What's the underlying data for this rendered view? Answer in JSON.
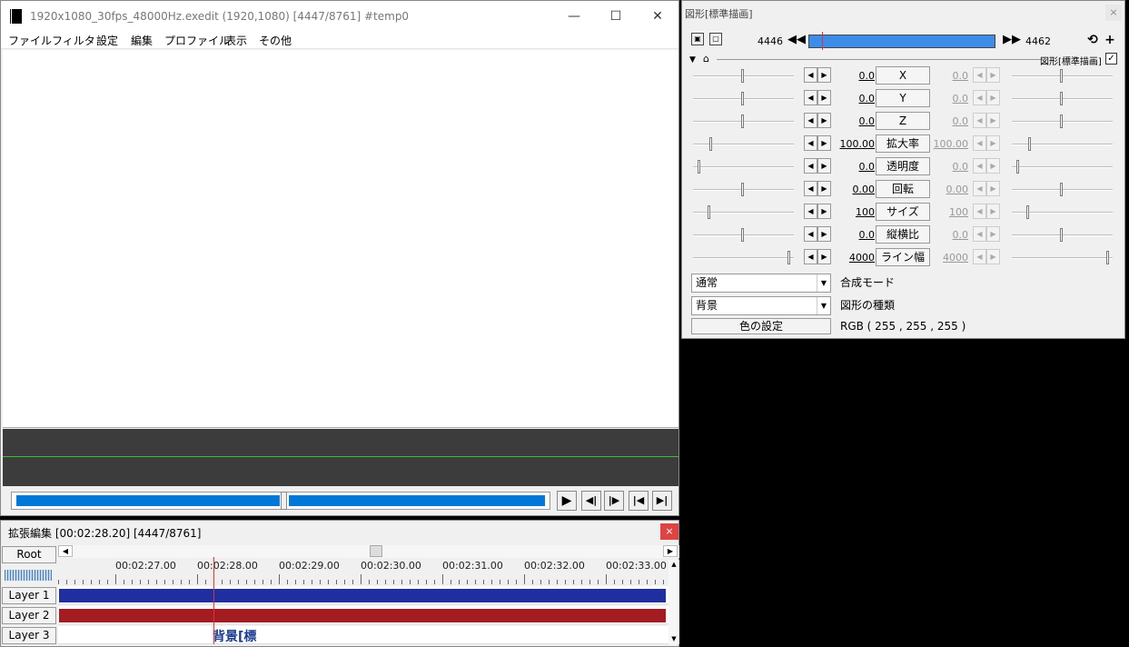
{
  "main_window": {
    "title": "1920x1080_30fps_48000Hz.exedit (1920,1080)  [4447/8761]  #temp0",
    "menu": [
      "ファイル",
      "フィルタ",
      "設定",
      "編集",
      "プロファイル",
      "表示",
      "その他"
    ],
    "window_buttons": {
      "minimize": "—",
      "maximize": "☐",
      "close": "✕"
    },
    "seek_progress": 0.507,
    "playback": {
      "play": "▶",
      "prev": "◀|",
      "next": "|▶",
      "first": "|◀",
      "last": "▶|"
    }
  },
  "timeline": {
    "title": "拡張編集 [00:02:28.20] [4447/8761]",
    "close": "×",
    "root_label": "Root",
    "time_labels": [
      "00:02:27.00",
      "00:02:28.00",
      "00:02:29.00",
      "00:02:30.00",
      "00:02:31.00",
      "00:02:32.00",
      "00:02:33.00"
    ],
    "layers": [
      {
        "label": "Layer 1",
        "clip_color": "#1f2fa0"
      },
      {
        "label": "Layer 2",
        "clip_color": "#a31c22"
      },
      {
        "label": "Layer 3",
        "clip_color": ""
      }
    ],
    "layer3_text": "背景[標",
    "scroll_left": "◀",
    "scroll_right": "▶",
    "scroll_up": "▲",
    "scroll_down": "▼"
  },
  "properties": {
    "title": "図形[標準描画]",
    "close": "×",
    "start_frame": "4446",
    "end_frame": "4462",
    "section_label": "図形[標準描画]",
    "checkmark": "✓",
    "params": [
      {
        "label": "X",
        "left": "0.0",
        "right": "0.0",
        "slider": 0.5,
        "slider_r": 0.5
      },
      {
        "label": "Y",
        "left": "0.0",
        "right": "0.0",
        "slider": 0.5,
        "slider_r": 0.5
      },
      {
        "label": "Z",
        "left": "0.0",
        "right": "0.0",
        "slider": 0.5,
        "slider_r": 0.5
      },
      {
        "label": "拡大率",
        "left": "100.00",
        "right": "100.00",
        "slider": 0.17,
        "slider_r": 0.17
      },
      {
        "label": "透明度",
        "left": "0.0",
        "right": "0.0",
        "slider": 0.05,
        "slider_r": 0.05
      },
      {
        "label": "回転",
        "left": "0.00",
        "right": "0.00",
        "slider": 0.5,
        "slider_r": 0.5
      },
      {
        "label": "サイズ",
        "left": "100",
        "right": "100",
        "slider": 0.15,
        "slider_r": 0.15
      },
      {
        "label": "縦横比",
        "left": "0.0",
        "right": "0.0",
        "slider": 0.5,
        "slider_r": 0.5
      },
      {
        "label": "ライン幅",
        "left": "4000",
        "right": "4000",
        "slider": 0.98,
        "slider_r": 0.98
      }
    ],
    "blend_mode_value": "通常",
    "blend_mode_label": "合成モード",
    "shape_value": "背景",
    "shape_label": "図形の種類",
    "color_button": "色の設定",
    "color_value": "RGB ( 255 , 255 , 255 )"
  }
}
